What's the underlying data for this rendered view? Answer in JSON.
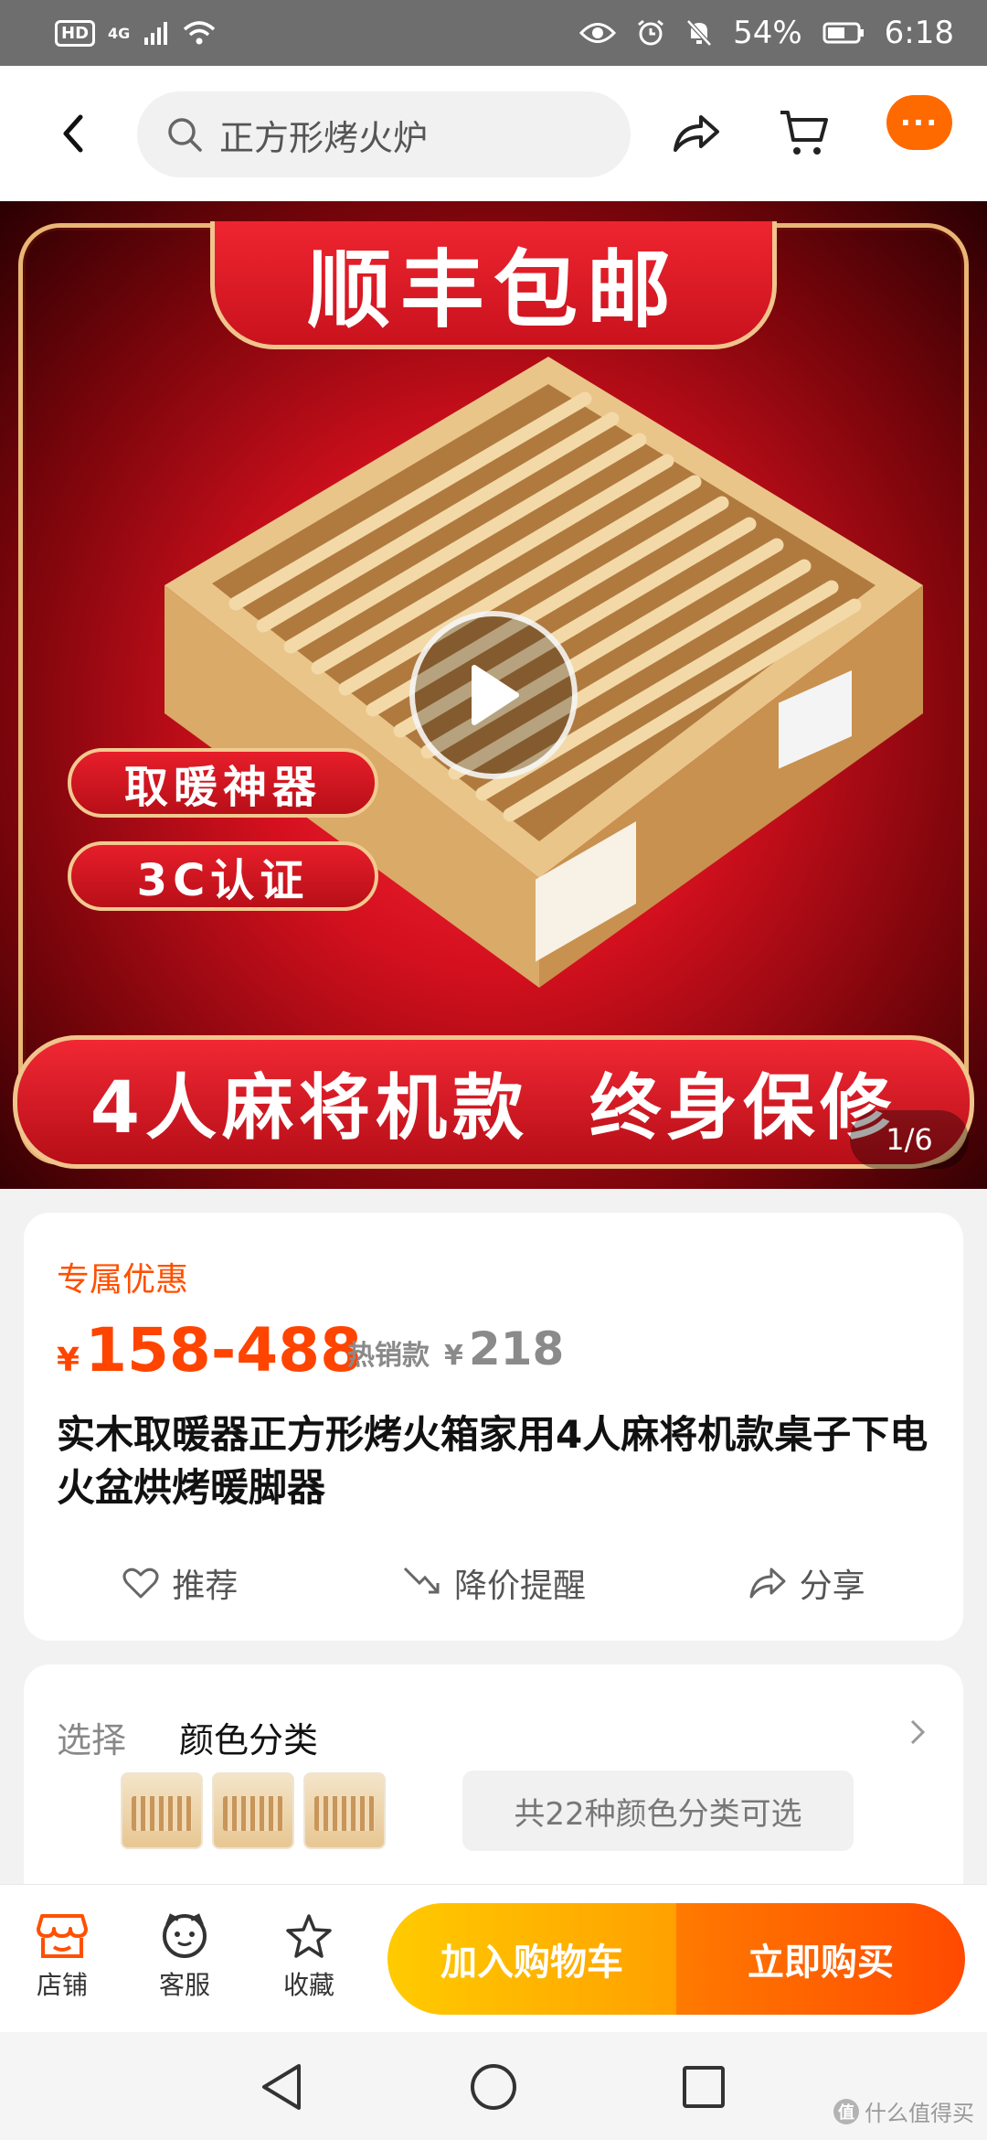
{
  "status_bar": {
    "hd": "HD",
    "network": "4G",
    "battery": "54%",
    "time": "6:18"
  },
  "search": {
    "placeholder": "正方形烤火炉"
  },
  "nav": {
    "more_label": "···"
  },
  "banner": {
    "headline": "顺丰包邮",
    "badges": [
      "取暖神器",
      "3C认证"
    ],
    "bottom_ribbon": "4人麻将机款  终身保修",
    "pager": "1/6"
  },
  "product": {
    "promo_label": "专属优惠",
    "currency": "¥",
    "price_range": "158-488",
    "hot_label": "热销款",
    "hot_price": "218",
    "title": "实木取暖器正方形烤火箱家用4人麻将机款桌子下电火盆烘烤暖脚器",
    "actions": [
      {
        "label": "推荐",
        "icon": "heart-icon"
      },
      {
        "label": "降价提醒",
        "icon": "price-drop-icon"
      },
      {
        "label": "分享",
        "icon": "share-icon"
      }
    ]
  },
  "sku": {
    "select_label": "选择",
    "category_title": "颜色分类",
    "count_text": "共22种颜色分类可选"
  },
  "bottom_bar": {
    "items": [
      {
        "label": "店铺",
        "icon": "shop-icon"
      },
      {
        "label": "客服",
        "icon": "customer-service-icon"
      },
      {
        "label": "收藏",
        "icon": "star-icon"
      }
    ],
    "add_to_cart": "加入购物车",
    "buy_now": "立即购买"
  },
  "watermark": {
    "text": "什么值得买",
    "logo": "值"
  },
  "colors": {
    "accent": "#ff5000",
    "cart_gradient": "#ffb300",
    "buy_gradient": "#ff5a00"
  }
}
